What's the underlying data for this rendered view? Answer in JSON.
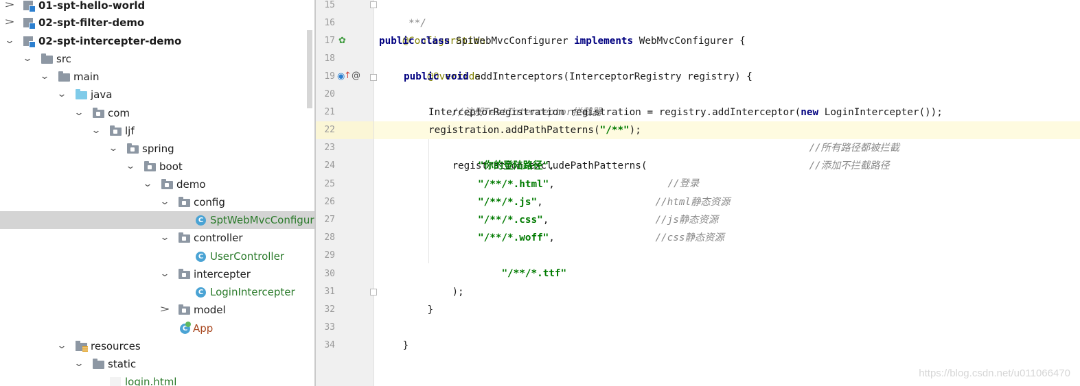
{
  "tree": {
    "items": [
      {
        "label": "01-spt-hello-world"
      },
      {
        "label": "02-spt-filter-demo"
      },
      {
        "label": "02-spt-intercepter-demo"
      },
      {
        "label": "src"
      },
      {
        "label": "main"
      },
      {
        "label": "java"
      },
      {
        "label": "com"
      },
      {
        "label": "ljf"
      },
      {
        "label": "spring"
      },
      {
        "label": "boot"
      },
      {
        "label": "demo"
      },
      {
        "label": "config"
      },
      {
        "label": "SptWebMvcConfigurer"
      },
      {
        "label": "controller"
      },
      {
        "label": "UserController"
      },
      {
        "label": "intercepter"
      },
      {
        "label": "LoginIntercepter"
      },
      {
        "label": "model"
      },
      {
        "label": "App"
      },
      {
        "label": "resources"
      },
      {
        "label": "static"
      },
      {
        "label": "login.html"
      }
    ]
  },
  "editor": {
    "line_numbers": [
      "15",
      "16",
      "17",
      "18",
      "19",
      "20",
      "21",
      "22",
      "23",
      "24",
      "25",
      "26",
      "27",
      "28",
      "29",
      "30",
      "31",
      "32",
      "33",
      "34"
    ],
    "current_line": "22",
    "lines": {
      "l15": {
        "c": " **/"
      },
      "l16": {
        "a": "@Configuration"
      },
      "l17": {
        "k1": "public class ",
        "t1": "SptWebMvcConfigurer ",
        "k2": "implements ",
        "t2": "WebMvcConfigurer {"
      },
      "l18": {
        "a": "@Override"
      },
      "l19": {
        "k1": "public void ",
        "t1": "addInterceptors(InterceptorRegistry registry) {"
      },
      "l20": {
        "c": "//注册TestInterceptor拦截器"
      },
      "l21": {
        "t1": "InterceptorRegistration registration = registry.addInterceptor(",
        "k1": "new ",
        "t2": "LoginIntercepter());"
      },
      "l22": {
        "t1": "registration.addPathPatterns(",
        "s": "\"/**\"",
        "t2": ");",
        "c": "//所有路径都被拦截"
      },
      "l23": {
        "t1": "registration.excludePathPatterns(",
        "c": "//添加不拦截路径"
      },
      "l24": {
        "s": "\"你的登陆路径\"",
        "t1": ",",
        "c": "//登录"
      },
      "l25": {
        "s": "\"/**/*.html\"",
        "t1": ",",
        "c": "//html静态资源"
      },
      "l26": {
        "s": "\"/**/*.js\"",
        "t1": ",",
        "c": "//js静态资源"
      },
      "l27": {
        "s": "\"/**/*.css\"",
        "t1": ",",
        "c": "//css静态资源"
      },
      "l28": {
        "s": "\"/**/*.woff\"",
        "t1": ","
      },
      "l29": {
        "s": "\"/**/*.ttf\""
      },
      "l30": {
        "t1": ");"
      },
      "l31": {
        "t1": "}"
      },
      "l33": {
        "t1": "}"
      }
    }
  },
  "watermark": "https://blog.csdn.net/u011066470",
  "colors": {
    "keyword": "#000080",
    "annotation": "#808000",
    "string": "#007a00",
    "comment": "#8a8a8a",
    "class_label": "#2a7a2a",
    "selection": "#d4d4d4",
    "current_line": "#fefbe0"
  }
}
